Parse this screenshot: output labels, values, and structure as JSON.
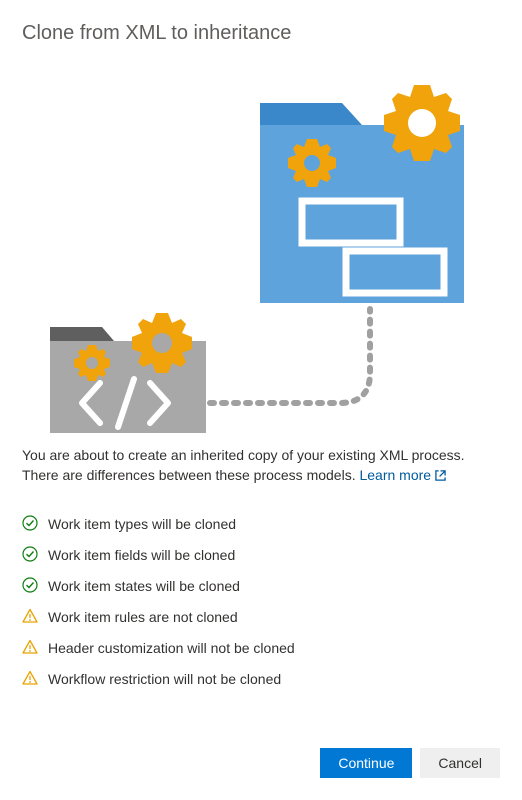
{
  "title": "Clone from XML to inheritance",
  "description_prefix": "You are about to create an inherited copy of your existing XML process. There are differences between these process models. ",
  "learn_more_label": "Learn more",
  "checklist": [
    {
      "icon": "success",
      "text": "Work item types will be cloned"
    },
    {
      "icon": "success",
      "text": "Work item fields will be cloned"
    },
    {
      "icon": "success",
      "text": "Work item states will be cloned"
    },
    {
      "icon": "warning",
      "text": "Work item rules are not cloned"
    },
    {
      "icon": "warning",
      "text": "Header customization will not be cloned"
    },
    {
      "icon": "warning",
      "text": "Workflow restriction will not be cloned"
    }
  ],
  "buttons": {
    "continue": "Continue",
    "cancel": "Cancel"
  }
}
